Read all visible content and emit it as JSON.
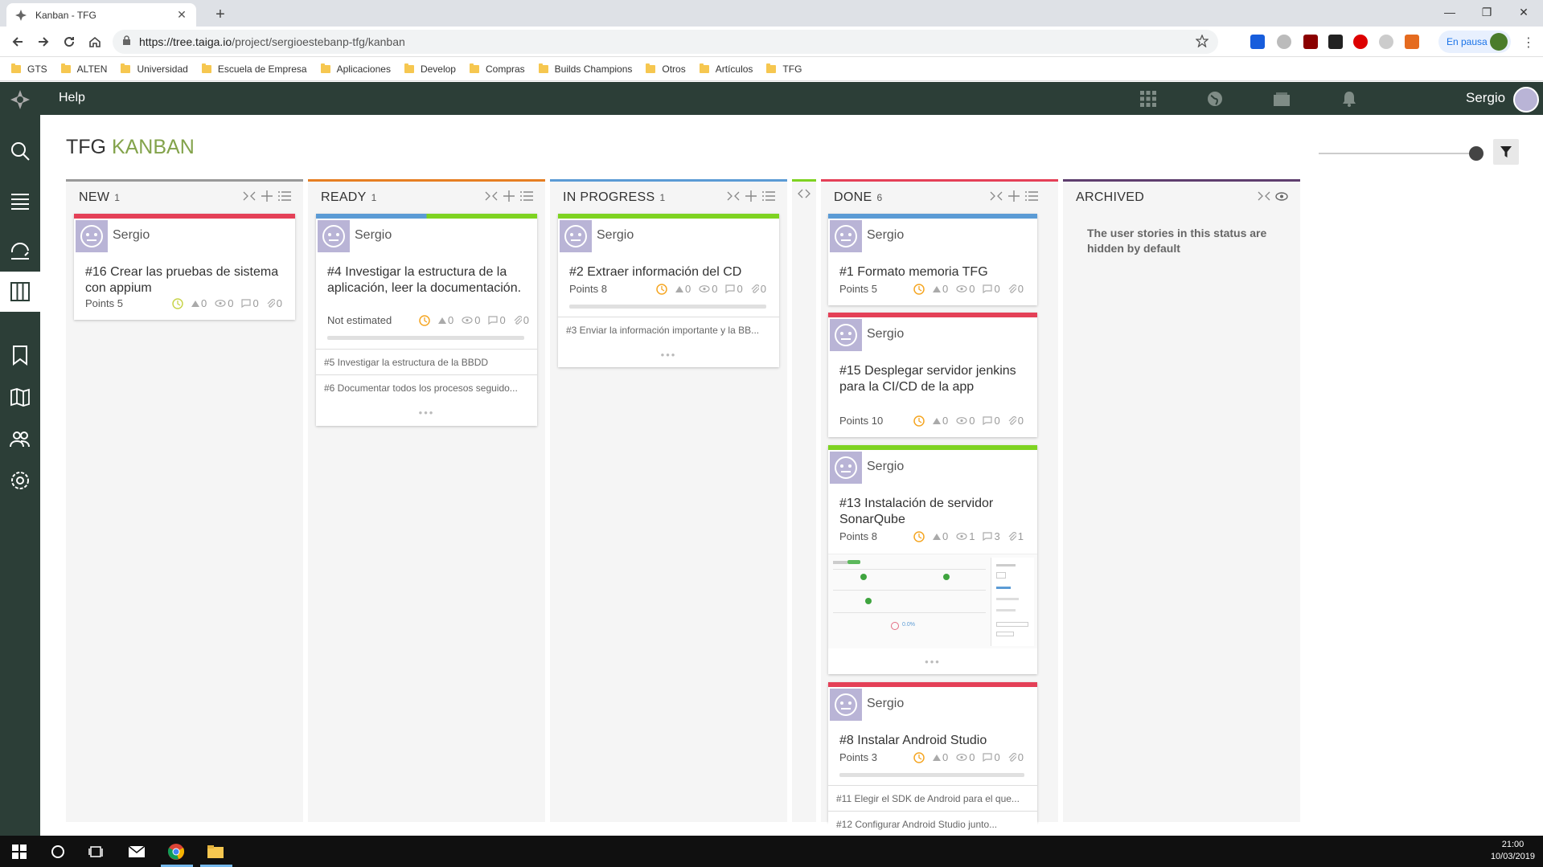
{
  "browser": {
    "tab_title": "Kanban - TFG",
    "url_host": "https://tree.taiga.io",
    "url_path": "/project/sergioestebanp-tfg/kanban",
    "profile_status": "En pausa",
    "bookmarks": [
      "GTS",
      "ALTEN",
      "Universidad",
      "Escuela de Empresa",
      "Aplicaciones",
      "Develop",
      "Compras",
      "Builds Champions",
      "Otros",
      "Artículos",
      "TFG"
    ]
  },
  "topbar": {
    "help": "Help",
    "user_name": "Sergio"
  },
  "page": {
    "title_project": "TFG",
    "title_section": "KANBAN"
  },
  "columns": {
    "new": {
      "name": "NEW",
      "count": "1",
      "color": "#e44057"
    },
    "ready": {
      "name": "READY",
      "count": "1",
      "color": "#e67e22"
    },
    "in_progress": {
      "name": "IN PROGRESS",
      "count": "1",
      "color": "#5b9bd5"
    },
    "done": {
      "name": "DONE",
      "count": "6",
      "color": "#e44057"
    },
    "archived": {
      "name": "ARCHIVED",
      "message": "The user stories in this status are hidden by default",
      "color": "#5e3e6e"
    }
  },
  "cards": {
    "c16": {
      "owner": "Sergio",
      "title": "#16 Crear las pruebas de sistema con appium",
      "points": "Points 5",
      "votes": "0",
      "watchers": "0",
      "comments": "0",
      "attachments": "0"
    },
    "c4": {
      "owner": "Sergio",
      "title": "#4 Investigar la estructura de la aplicación, leer la documentación.",
      "points": "Not estimated",
      "votes": "0",
      "watchers": "0",
      "comments": "0",
      "attachments": "0",
      "tasks": [
        "#5 Investigar la estructura de la BBDD",
        "#6 Documentar todos los procesos seguido..."
      ]
    },
    "c2": {
      "owner": "Sergio",
      "title": "#2 Extraer información del CD",
      "points": "Points 8",
      "votes": "0",
      "watchers": "0",
      "comments": "0",
      "attachments": "0",
      "tasks": [
        "#3 Enviar la información importante y la BB..."
      ]
    },
    "c1": {
      "owner": "Sergio",
      "title": "#1 Formato memoria TFG",
      "points": "Points 5",
      "votes": "0",
      "watchers": "0",
      "comments": "0",
      "attachments": "0"
    },
    "c15": {
      "owner": "Sergio",
      "title": "#15 Desplegar servidor jenkins para la CI/CD de la app",
      "points": "Points 10",
      "votes": "0",
      "watchers": "0",
      "comments": "0",
      "attachments": "0"
    },
    "c13": {
      "owner": "Sergio",
      "title": "#13 Instalación de servidor SonarQube",
      "points": "Points 8",
      "votes": "0",
      "watchers": "1",
      "comments": "3",
      "attachments": "1",
      "thumb_percent": "0.0%"
    },
    "c8": {
      "owner": "Sergio",
      "title": "#8 Instalar Android Studio",
      "points": "Points 3",
      "votes": "0",
      "watchers": "0",
      "comments": "0",
      "attachments": "0",
      "tasks": [
        "#11 Elegir el SDK de Android para el que...",
        "#12 Configurar Android Studio junto..."
      ]
    }
  },
  "taskbar": {
    "time": "21:00",
    "date": "10/03/2019"
  }
}
